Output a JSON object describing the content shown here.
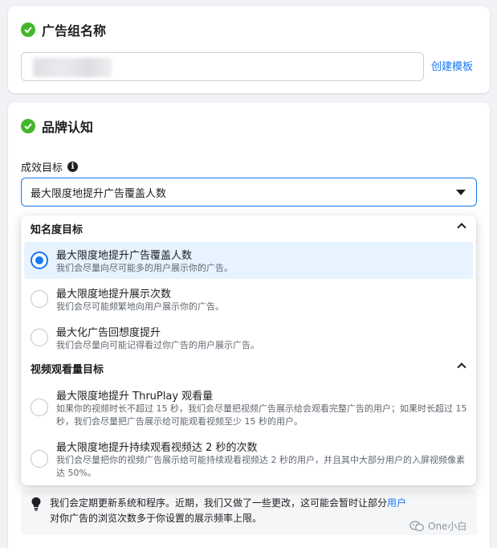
{
  "ad_group_section": {
    "title": "广告组名称",
    "create_template_link": "创建模板"
  },
  "brand_section": {
    "title": "品牌认知",
    "goal_label": "成效目标",
    "selected_goal": "最大限度地提升广告覆盖人数"
  },
  "dropdown": {
    "groups": [
      {
        "header": "知名度目标",
        "options": [
          {
            "title": "最大限度地提升广告覆盖人数",
            "desc": "我们会尽量向尽可能多的用户展示你的广告。",
            "selected": true
          },
          {
            "title": "最大限度地提升展示次数",
            "desc": "我们会尽可能频繁地向用户展示你的广告。",
            "selected": false
          },
          {
            "title": "最大化广告回想度提升",
            "desc": "我们会尽量向可能记得看过你广告的用户展示广告。",
            "selected": false
          }
        ]
      },
      {
        "header": "视频观看量目标",
        "options": [
          {
            "title": "最大限度地提升 ThruPlay 观看量",
            "desc": "如果你的视频时长不超过 15 秒，我们会尽量把视频广告展示给会观看完整广告的用户；如果时长超过 15 秒，我们会尽量把广告展示给可能观看视频至少 15 秒的用户。",
            "selected": false
          },
          {
            "title": "最大限度地提升持续观看视频达 2 秒的次数",
            "desc": "我们会尽量把你的视频广告展示给可能持续观看视频达 2 秒的用户，并且其中大部分用户的入屏视频像素达 50%。",
            "selected": false
          }
        ]
      }
    ]
  },
  "notice": {
    "text": "我们会定期更新系统和程序。近期，我们又做了一些更改，这可能会暂时让部分",
    "link": "用户",
    "text_after": "对你广告的浏览次数多于你设置的展示频率上限。"
  },
  "watermark": {
    "text": "One小白"
  },
  "colors": {
    "accent": "#1877f2",
    "success": "#42b72a",
    "selected_bg": "#e7f3ff"
  }
}
